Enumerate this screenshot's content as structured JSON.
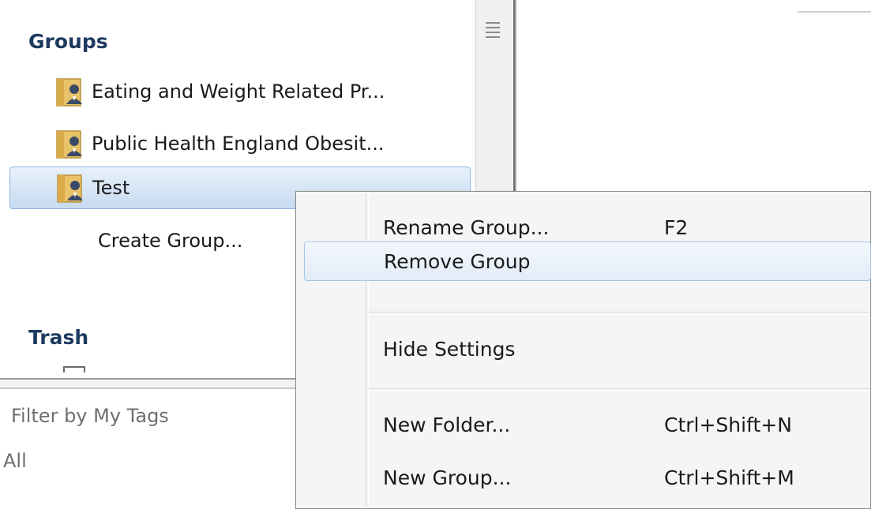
{
  "sidebar": {
    "groups_header": "Groups",
    "groups": [
      {
        "label": "Eating and Weight Related Pr...",
        "icon": "group-folder-icon"
      },
      {
        "label": "Public Health England Obesit...",
        "icon": "group-folder-icon"
      },
      {
        "label": "Test",
        "icon": "group-folder-icon",
        "selected": true
      }
    ],
    "create_group_label": "Create Group...",
    "trash_header": "Trash"
  },
  "filter": {
    "label": "Filter by My Tags",
    "value": "All"
  },
  "context_menu": {
    "items": [
      {
        "label": "Rename Group...",
        "shortcut": "F2"
      },
      {
        "label": "Remove Group",
        "shortcut": "",
        "highlighted": true
      },
      {
        "label": "Hide Settings",
        "shortcut": ""
      },
      {
        "label": "New Folder...",
        "shortcut": "Ctrl+Shift+N"
      },
      {
        "label": "New Group...",
        "shortcut": "Ctrl+Shift+M"
      }
    ]
  },
  "colors": {
    "section_header": "#1e3a5f",
    "selection_border": "#8db2e3",
    "menu_highlight_border": "#a8c6ea",
    "menu_background": "#f5f5f5"
  }
}
